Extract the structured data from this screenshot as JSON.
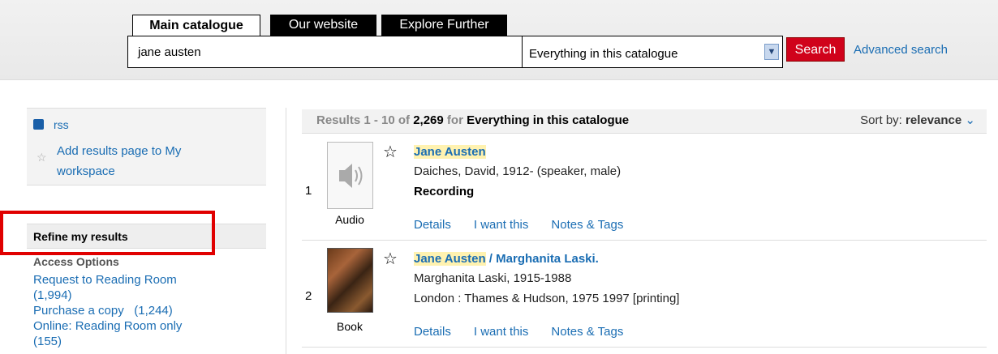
{
  "tabs": [
    "Main catalogue",
    "Our website",
    "Explore Further"
  ],
  "search": {
    "query": "jane austen",
    "scope": "Everything in this catalogue",
    "button": "Search",
    "advanced": "Advanced search"
  },
  "sidebar": {
    "rss": "rss",
    "add_workspace": "Add results page to My workspace",
    "refine": "Refine my results",
    "access_options": "Access Options",
    "facets": [
      "Request to Reading Room   (1,994)",
      "Purchase a copy   (1,244)",
      "Online: Reading Room only   (155)"
    ]
  },
  "results_bar": {
    "prefix": "Results 1 - 10 of ",
    "total": "2,269",
    "for_text": "for",
    "scope": "Everything in this catalogue",
    "sort_label": "Sort by:",
    "sort_value": "relevance"
  },
  "results": [
    {
      "num": "1",
      "type": "Audio",
      "title_hl": "Jane Austen",
      "title_rest": "",
      "line1": "Daiches, David, 1912- (speaker, male)",
      "line2": "Recording",
      "links": [
        "Details",
        "I want this",
        "Notes & Tags"
      ]
    },
    {
      "num": "2",
      "type": "Book",
      "title_hl": "Jane Austen",
      "title_rest": " / Marghanita Laski.",
      "line1": "Marghanita Laski, 1915-1988",
      "line2": "London : Thames & Hudson, 1975 1997 [printing]",
      "links": [
        "Details",
        "I want this",
        "Notes & Tags"
      ]
    }
  ],
  "colors": {
    "accent_red": "#d0021b",
    "link_blue": "#1a6db3"
  }
}
